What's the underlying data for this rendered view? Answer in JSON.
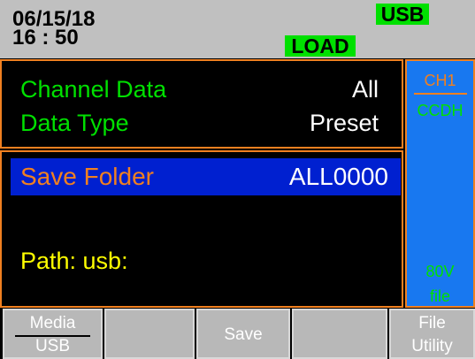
{
  "status": {
    "date": "06/15/18",
    "time": "16 : 50",
    "usb_badge": "USB",
    "load_badge": "LOAD"
  },
  "settings": {
    "channel_data_label": "Channel Data",
    "channel_data_value": "All",
    "data_type_label": "Data Type",
    "data_type_value": "Preset"
  },
  "save": {
    "folder_label": "Save Folder",
    "folder_value": "ALL0000",
    "path": "Path:  usb:"
  },
  "side": {
    "channel": "CH1",
    "mode": "CCDH",
    "voltage": "80V",
    "file": "file"
  },
  "softkeys": {
    "media_label": "Media",
    "media_value": "USB",
    "save": "Save",
    "file_utility_line1": "File",
    "file_utility_line2": "Utility"
  },
  "colors": {
    "accent_orange": "#f08020",
    "highlight_blue": "#0020d0",
    "side_blue": "#1878f0",
    "green": "#00e000",
    "yellow": "#ffff00"
  }
}
